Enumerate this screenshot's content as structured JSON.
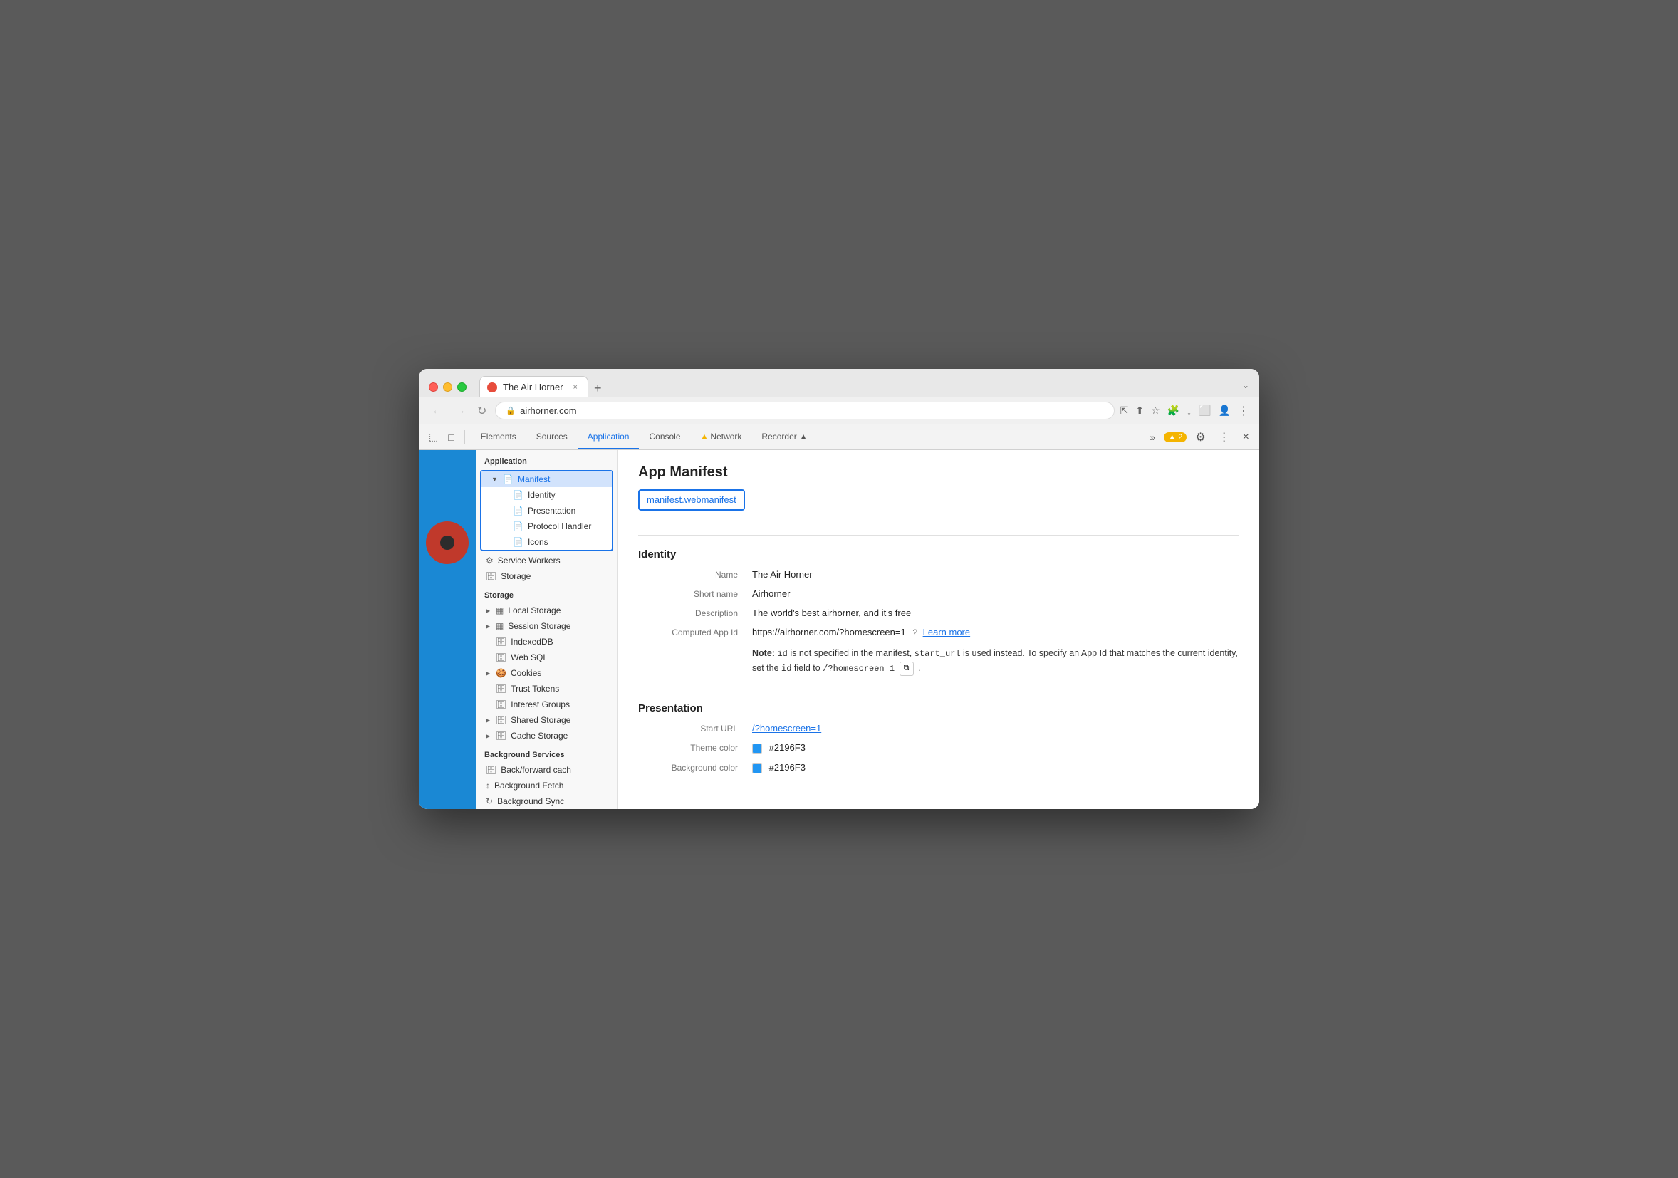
{
  "browser": {
    "tab_title": "The Air Horner",
    "tab_close": "×",
    "tab_new": "+",
    "address": "airhorner.com",
    "window_controls_chevron": "⌄"
  },
  "nav": {
    "back": "←",
    "forward": "→",
    "refresh": "↻",
    "lock_icon": "🔒"
  },
  "address_bar_actions": {
    "icons": [
      "⇱",
      "⬆",
      "☆",
      "🧩",
      "↓",
      "⬜",
      "👤",
      "⋮"
    ]
  },
  "devtools": {
    "tools_left": [
      "⬚",
      "□"
    ],
    "tabs": [
      {
        "label": "Elements",
        "active": false
      },
      {
        "label": "Sources",
        "active": false
      },
      {
        "label": "Application",
        "active": true
      },
      {
        "label": "Console",
        "active": false
      },
      {
        "label": "Network",
        "active": false,
        "warn": true
      },
      {
        "label": "Recorder ▲",
        "active": false
      }
    ],
    "more_tabs": "»",
    "warn_count": "▲ 2",
    "settings_icon": "⚙",
    "more_icon": "⋮",
    "close_icon": "×"
  },
  "sidebar": {
    "app_section_label": "Application",
    "manifest_label": "Manifest",
    "manifest_children": [
      {
        "label": "Identity"
      },
      {
        "label": "Presentation"
      },
      {
        "label": "Protocol Handler"
      },
      {
        "label": "Icons"
      }
    ],
    "service_workers_label": "Service Workers",
    "storage_label": "Storage",
    "storage_section_label": "Storage",
    "storage_items": [
      {
        "label": "Local Storage",
        "expandable": true
      },
      {
        "label": "Session Storage",
        "expandable": true
      },
      {
        "label": "IndexedDB",
        "expandable": false
      },
      {
        "label": "Web SQL",
        "expandable": false
      },
      {
        "label": "Cookies",
        "expandable": true
      },
      {
        "label": "Trust Tokens",
        "expandable": false
      },
      {
        "label": "Interest Groups",
        "expandable": false
      },
      {
        "label": "Shared Storage",
        "expandable": true
      },
      {
        "label": "Cache Storage",
        "expandable": true
      }
    ],
    "bg_services_label": "Background Services",
    "bg_services": [
      {
        "label": "Back/forward cach"
      },
      {
        "label": "Background Fetch"
      },
      {
        "label": "Background Sync"
      }
    ]
  },
  "main": {
    "page_title": "App Manifest",
    "manifest_link": "manifest.webmanifest",
    "identity_section": "Identity",
    "identity_rows": [
      {
        "label": "Name",
        "value": "The Air Horner"
      },
      {
        "label": "Short name",
        "value": "Airhorner"
      },
      {
        "label": "Description",
        "value": "The world's best airhorner, and it's free"
      },
      {
        "label": "Computed App Id",
        "value": "https://airhorner.com/?homescreen=1",
        "extra_link": "Learn more"
      }
    ],
    "note_text_1": "Note:",
    "note_code_1": "id",
    "note_text_2": " is not specified in the manifest, ",
    "note_code_2": "start_url",
    "note_text_3": " is used instead. To specify an App Id that matches the current identity, set the ",
    "note_code_3": "id",
    "note_text_4": " field to ",
    "note_code_4": "/?homescreen=1",
    "note_copy_btn": "⧉",
    "note_text_5": ".",
    "presentation_section": "Presentation",
    "presentation_rows": [
      {
        "label": "Start URL",
        "value": "/?homescreen=1",
        "link": true
      },
      {
        "label": "Theme color",
        "value": "#2196F3",
        "color": "#2196F3"
      },
      {
        "label": "Background color",
        "value": "#2196F3",
        "color": "#2196F3"
      }
    ]
  }
}
